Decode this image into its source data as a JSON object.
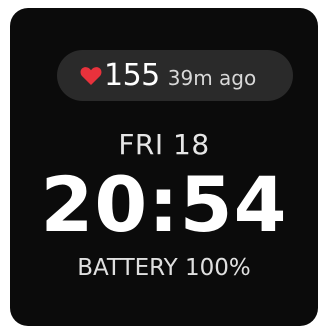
{
  "heart_rate": {
    "icon": "heart-icon",
    "icon_color": "#e8323c",
    "value": "155",
    "age": "39m ago"
  },
  "date": "FRI 18",
  "time": "20:54",
  "battery": "BATTERY 100%"
}
